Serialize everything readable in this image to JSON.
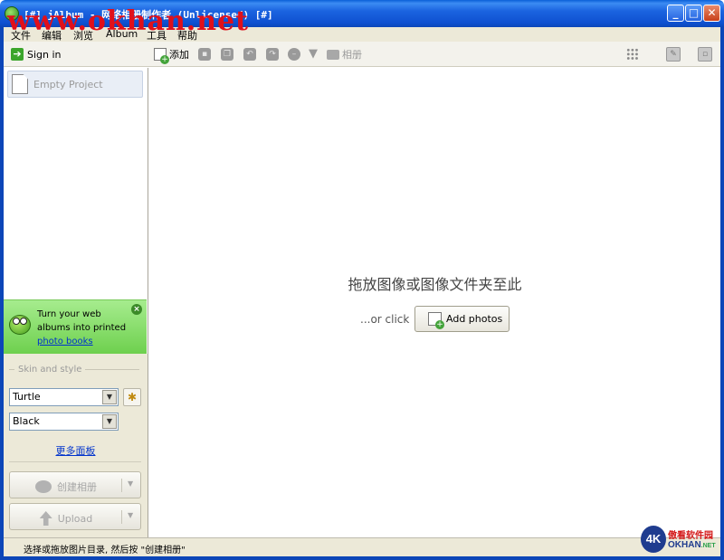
{
  "window": {
    "title": "[#] jAlbum - 网络相册制作者 (Unlicensed) [#]",
    "watermark": "www.okhan.net",
    "buttons": {
      "minimize": "_",
      "maximize": "□",
      "close": "✕"
    }
  },
  "menu": [
    "文件",
    "编辑",
    "浏览",
    "Album",
    "工具",
    "帮助"
  ],
  "sidebar": {
    "sign_in": "Sign in",
    "project": "Empty Project",
    "promo": {
      "line1": "Turn your web",
      "line2": "albums into printed",
      "link": "photo books"
    },
    "skin": {
      "header": "Skin and style",
      "skin_value": "Turtle",
      "style_value": "Black",
      "more_link": "更多面板"
    },
    "make_album": "创建相册",
    "upload": "Upload"
  },
  "toolbar": {
    "add_label": "添加",
    "album_label": "相册"
  },
  "main": {
    "drop_hint": "拖放图像或图像文件夹至此",
    "or_click": "...or click",
    "add_photos": "Add photos"
  },
  "status": {
    "text": "选择或拖放图片目录, 然后按 \"创建相册\""
  },
  "logo": {
    "mark": "4K",
    "top": "傲看软件园",
    "bottom": "OKHAN",
    "suffix": ".NET"
  },
  "colors": {
    "titlebar": "#1b64e0",
    "promo_green": "#6ed04e",
    "link_blue": "#0033cc",
    "watermark_red": "#e0101a"
  }
}
